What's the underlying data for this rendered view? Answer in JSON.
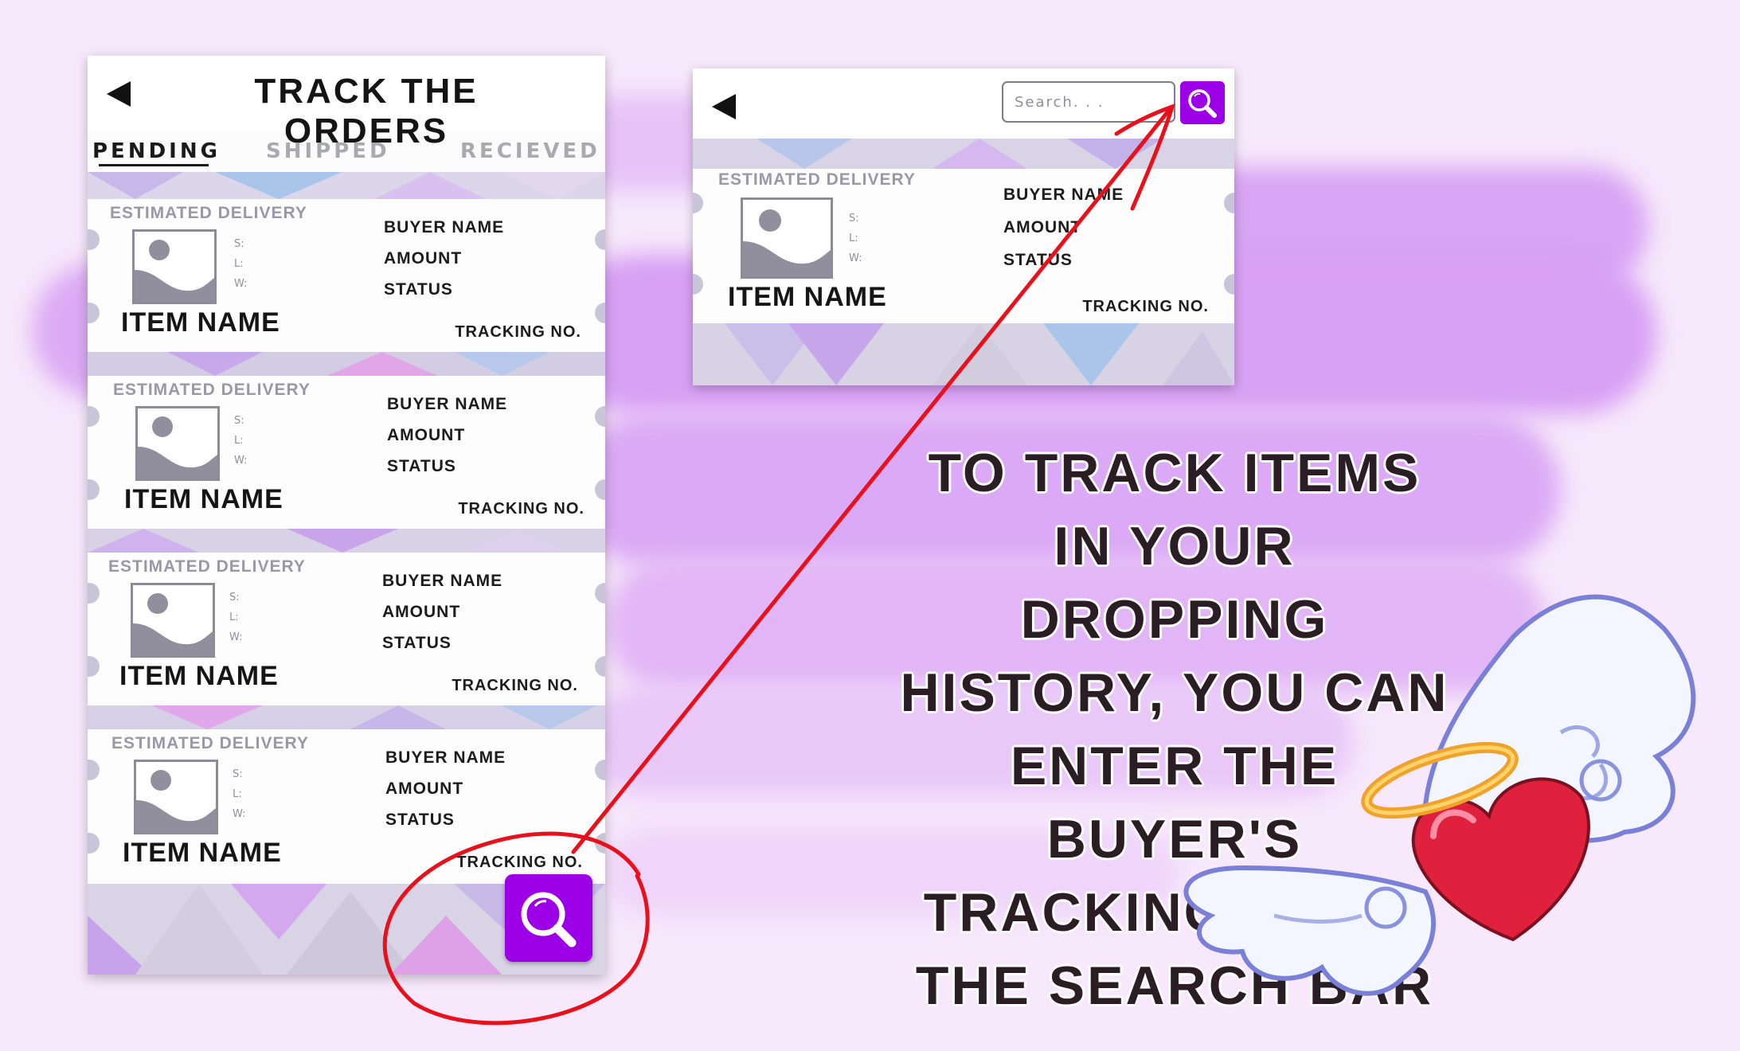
{
  "phone": {
    "title": "TRACK THE ORDERS",
    "tabs": [
      "PENDING",
      "SHIPPED",
      "RECIEVED"
    ],
    "active_tab": "PENDING",
    "cards": [
      {
        "estimated_delivery": "ESTIMATED DELIVERY",
        "item_name": "ITEM NAME",
        "dims": [
          "S:",
          "L:",
          "W:"
        ],
        "buyer_name": "BUYER NAME",
        "amount": "AMOUNT",
        "status": "STATUS",
        "tracking": "TRACKING NO."
      },
      {
        "estimated_delivery": "ESTIMATED DELIVERY",
        "item_name": "ITEM NAME",
        "dims": [
          "S:",
          "L:",
          "W:"
        ],
        "buyer_name": "BUYER NAME",
        "amount": "AMOUNT",
        "status": "STATUS",
        "tracking": "TRACKING NO."
      },
      {
        "estimated_delivery": "ESTIMATED DELIVERY",
        "item_name": "ITEM NAME",
        "dims": [
          "S:",
          "L:",
          "W:"
        ],
        "buyer_name": "BUYER NAME",
        "amount": "AMOUNT",
        "status": "STATUS",
        "tracking": "TRACKING NO."
      },
      {
        "estimated_delivery": "ESTIMATED DELIVERY",
        "item_name": "ITEM NAME",
        "dims": [
          "S:",
          "L:",
          "W:"
        ],
        "buyer_name": "BUYER NAME",
        "amount": "AMOUNT",
        "status": "STATUS",
        "tracking": "TRACKING NO."
      }
    ],
    "fab_icon": "search-icon"
  },
  "zoom": {
    "search_placeholder": "Search. . .",
    "search_button_icon": "search-icon",
    "card": {
      "estimated_delivery": "ESTIMATED DELIVERY",
      "item_name": "ITEM NAME",
      "dims": [
        "S:",
        "L:",
        "W:"
      ],
      "buyer_name": "BUYER NAME",
      "amount": "AMOUNT",
      "status": "STATUS",
      "tracking": "TRACKING NO."
    }
  },
  "caption": "TO TRACK ITEMS IN YOUR DROPPING HISTORY, YOU CAN ENTER THE BUYER'S TRACKING NO. IN THE SEARCH BAR",
  "decoration": "winged-heart-with-halo",
  "colors": {
    "accent": "#9b00e6",
    "annotation": "#e8111b",
    "background": "#f7e8fb",
    "brush": "#d79cf5"
  }
}
